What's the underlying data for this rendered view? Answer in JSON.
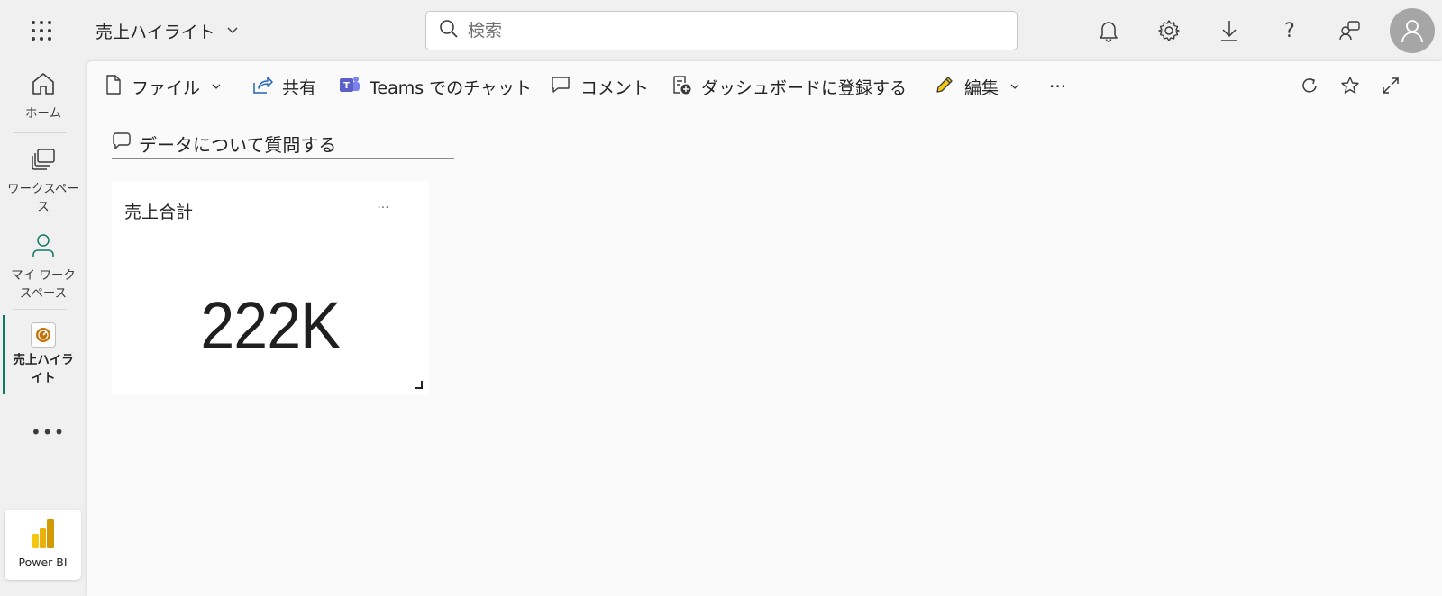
{
  "header": {
    "app_title": "売上ハイライト",
    "search_placeholder": "検索"
  },
  "leftnav": {
    "items": [
      {
        "label": "ホーム",
        "icon": "home-icon"
      },
      {
        "label": "ワークスペース",
        "icon": "workspaces-icon"
      },
      {
        "label": "マイ ワークスペース",
        "icon": "person-icon"
      },
      {
        "label": "売上ハイライト",
        "icon": "dashboard-gauge-icon",
        "active": true
      }
    ],
    "more_label": "•••",
    "app_switcher_label": "Power BI"
  },
  "commandbar": {
    "file": "ファイル",
    "share": "共有",
    "teams_chat": "Teams でのチャット",
    "comment": "コメント",
    "subscribe": "ダッシュボードに登録する",
    "edit": "編集",
    "more": "···"
  },
  "qa": {
    "prompt": "データについて質問する"
  },
  "tiles": [
    {
      "title": "売上合計",
      "value": "222K",
      "menu": "···"
    }
  ],
  "colors": {
    "accent": "#117865",
    "teams_purple": "#5b5fc7",
    "share_blue": "#2266b5",
    "powerbi_yellow": "#f2c811",
    "gauge_orange": "#c4720a"
  }
}
